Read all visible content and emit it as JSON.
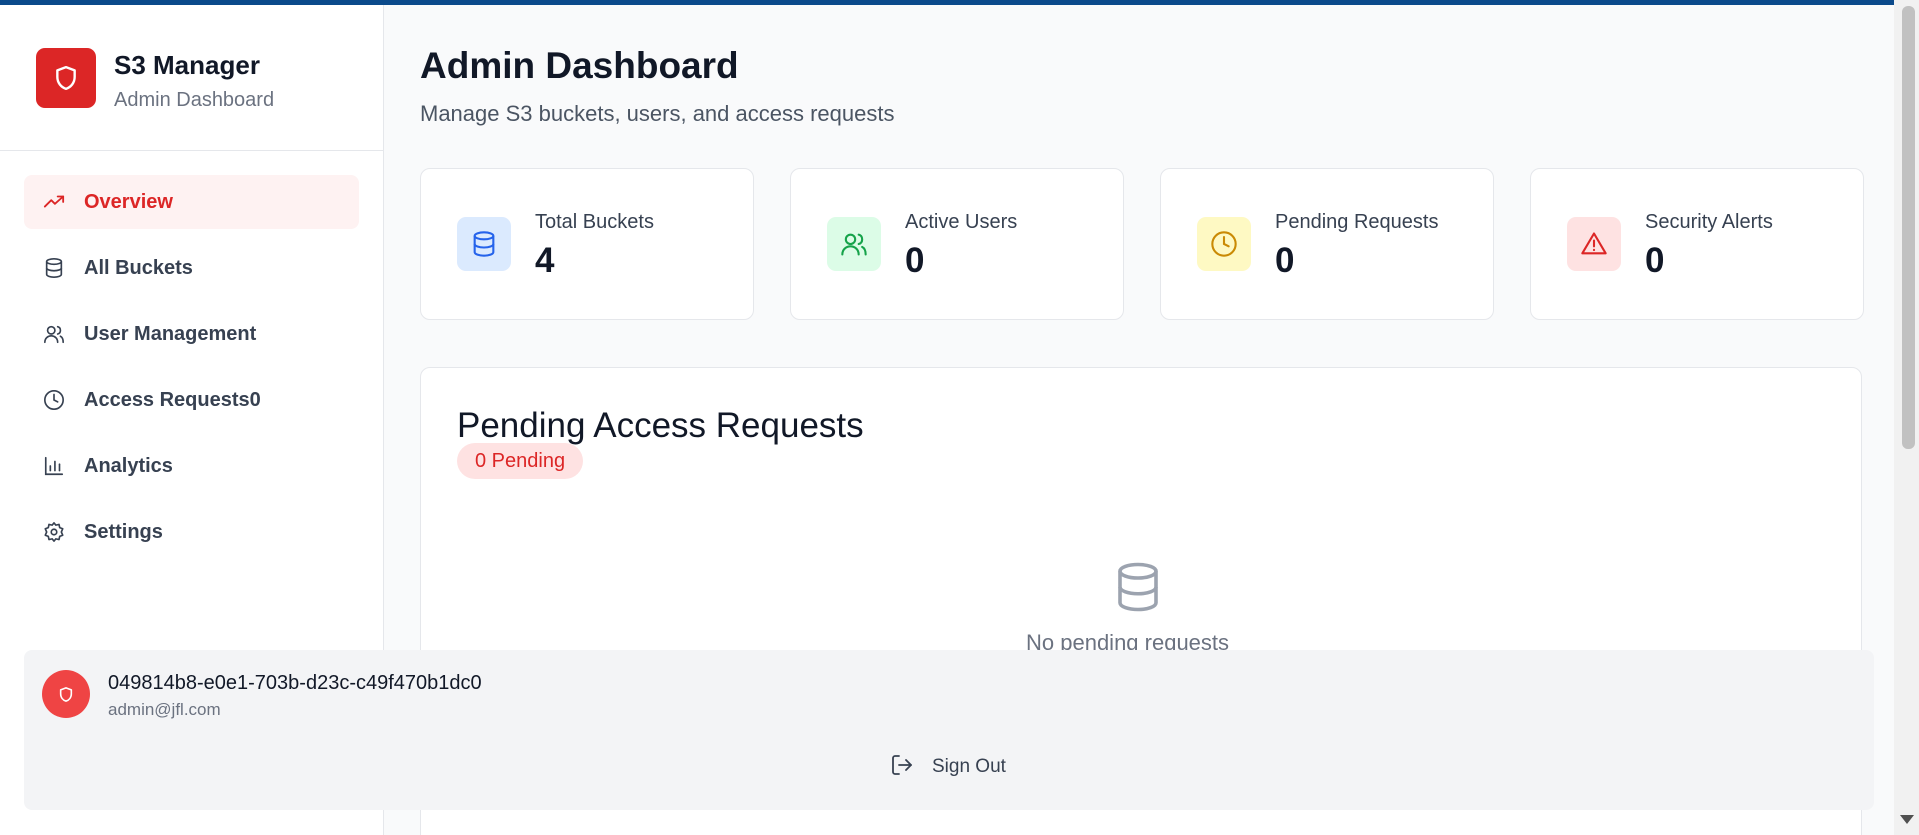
{
  "brand": {
    "title": "S3 Manager",
    "subtitle": "Admin Dashboard",
    "logo_icon": "shield-icon"
  },
  "sidebar": {
    "items": [
      {
        "label": "Overview",
        "icon": "trending-up-icon",
        "active": true
      },
      {
        "label": "All Buckets",
        "icon": "database-icon",
        "active": false
      },
      {
        "label": "User Management",
        "icon": "users-icon",
        "active": false
      },
      {
        "label": "Access Requests0",
        "icon": "clock-icon",
        "active": false
      },
      {
        "label": "Analytics",
        "icon": "bar-chart-icon",
        "active": false
      },
      {
        "label": "Settings",
        "icon": "gear-icon",
        "active": false
      }
    ]
  },
  "header": {
    "title": "Admin Dashboard",
    "subtitle": "Manage S3 buckets, users, and access requests"
  },
  "stats": [
    {
      "label": "Total Buckets",
      "value": "4",
      "icon": "database-icon",
      "bg": "#dbeafe",
      "fg": "#2563eb"
    },
    {
      "label": "Active Users",
      "value": "0",
      "icon": "users-icon",
      "bg": "#dcfce7",
      "fg": "#16a34a"
    },
    {
      "label": "Pending Requests",
      "value": "0",
      "icon": "clock-icon",
      "bg": "#fef9c3",
      "fg": "#ca8a04"
    },
    {
      "label": "Security Alerts",
      "value": "0",
      "icon": "alert-triangle-icon",
      "bg": "#fee2e2",
      "fg": "#dc2626"
    }
  ],
  "pending": {
    "title": "Pending Access Requests",
    "badge": "0 Pending",
    "empty_text": "No pending requests"
  },
  "user": {
    "id": "049814b8-e0e1-703b-d23c-c49f470b1dc0",
    "email": "admin@jfl.com",
    "sign_out": "Sign Out"
  },
  "colors": {
    "accent": "#dc2626",
    "topbar": "#0b4a8b"
  }
}
